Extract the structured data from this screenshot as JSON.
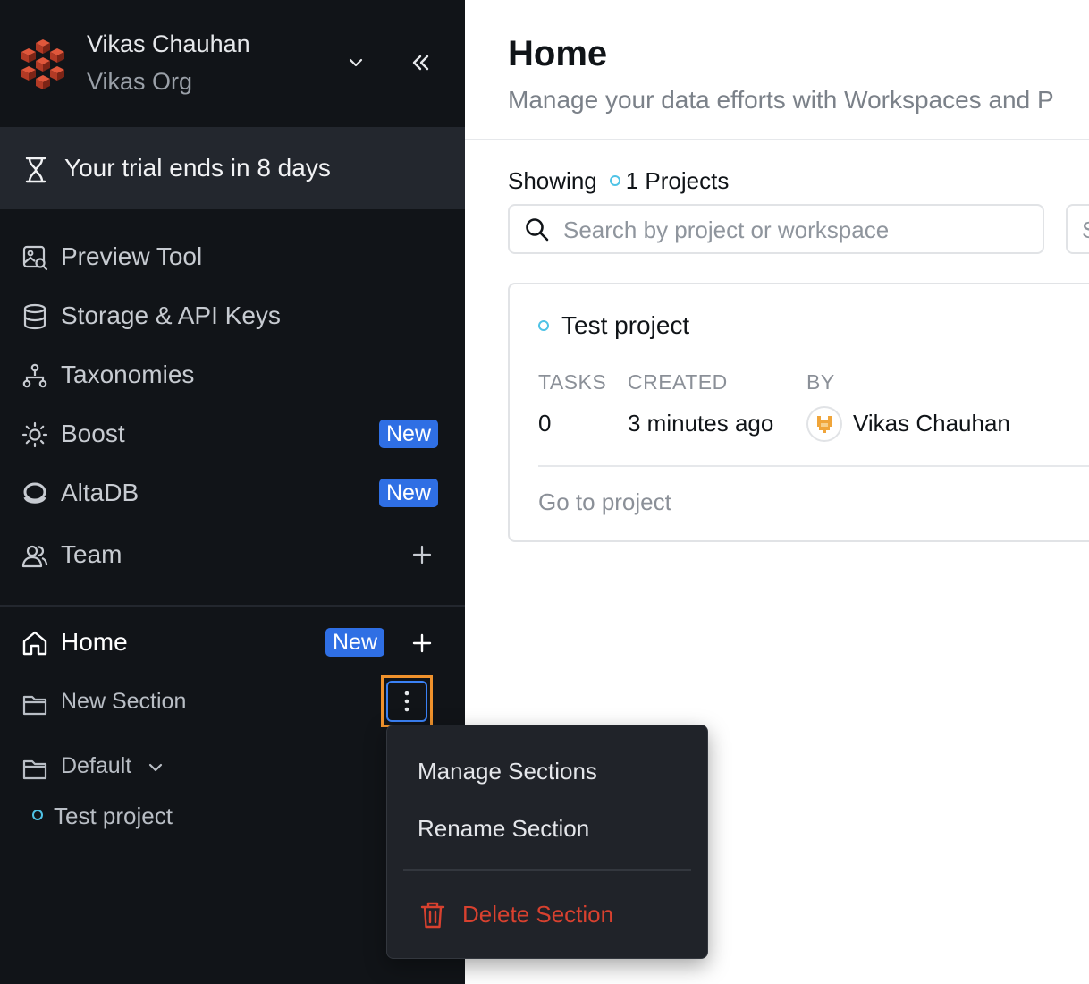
{
  "org": {
    "user_name": "Vikas Chauhan",
    "org_name": "Vikas Org"
  },
  "trial": {
    "text": "Your trial ends in 8 days"
  },
  "nav": {
    "preview_tool": "Preview Tool",
    "storage": "Storage & API Keys",
    "taxonomies": "Taxonomies",
    "boost": "Boost",
    "boost_badge": "New",
    "altadb": "AltaDB",
    "altadb_badge": "New",
    "team": "Team"
  },
  "home": {
    "label": "Home",
    "badge": "New"
  },
  "sections": {
    "new_section": "New Section",
    "default": "Default",
    "project": "Test project"
  },
  "context_menu": {
    "manage": "Manage Sections",
    "rename": "Rename Section",
    "delete": "Delete Section"
  },
  "main": {
    "title": "Home",
    "subtitle": "Manage your data efforts with Workspaces and P",
    "showing_label": "Showing",
    "showing_count": "1 Projects",
    "search_placeholder": "Search by project or workspace",
    "second_field_text": "S"
  },
  "project_card": {
    "title": "Test project",
    "tasks_header": "TASKS",
    "created_header": "CREATED",
    "by_header": "BY",
    "tasks_value": "0",
    "created_value": "3 minutes ago",
    "by_value": "Vikas Chauhan",
    "goto": "Go to project"
  },
  "colors": {
    "sidebar_bg": "#111418",
    "accent_badge": "#2f6fe4",
    "highlight": "#f0922c",
    "danger": "#d8412f",
    "project_dot": "#4fc3e6"
  }
}
